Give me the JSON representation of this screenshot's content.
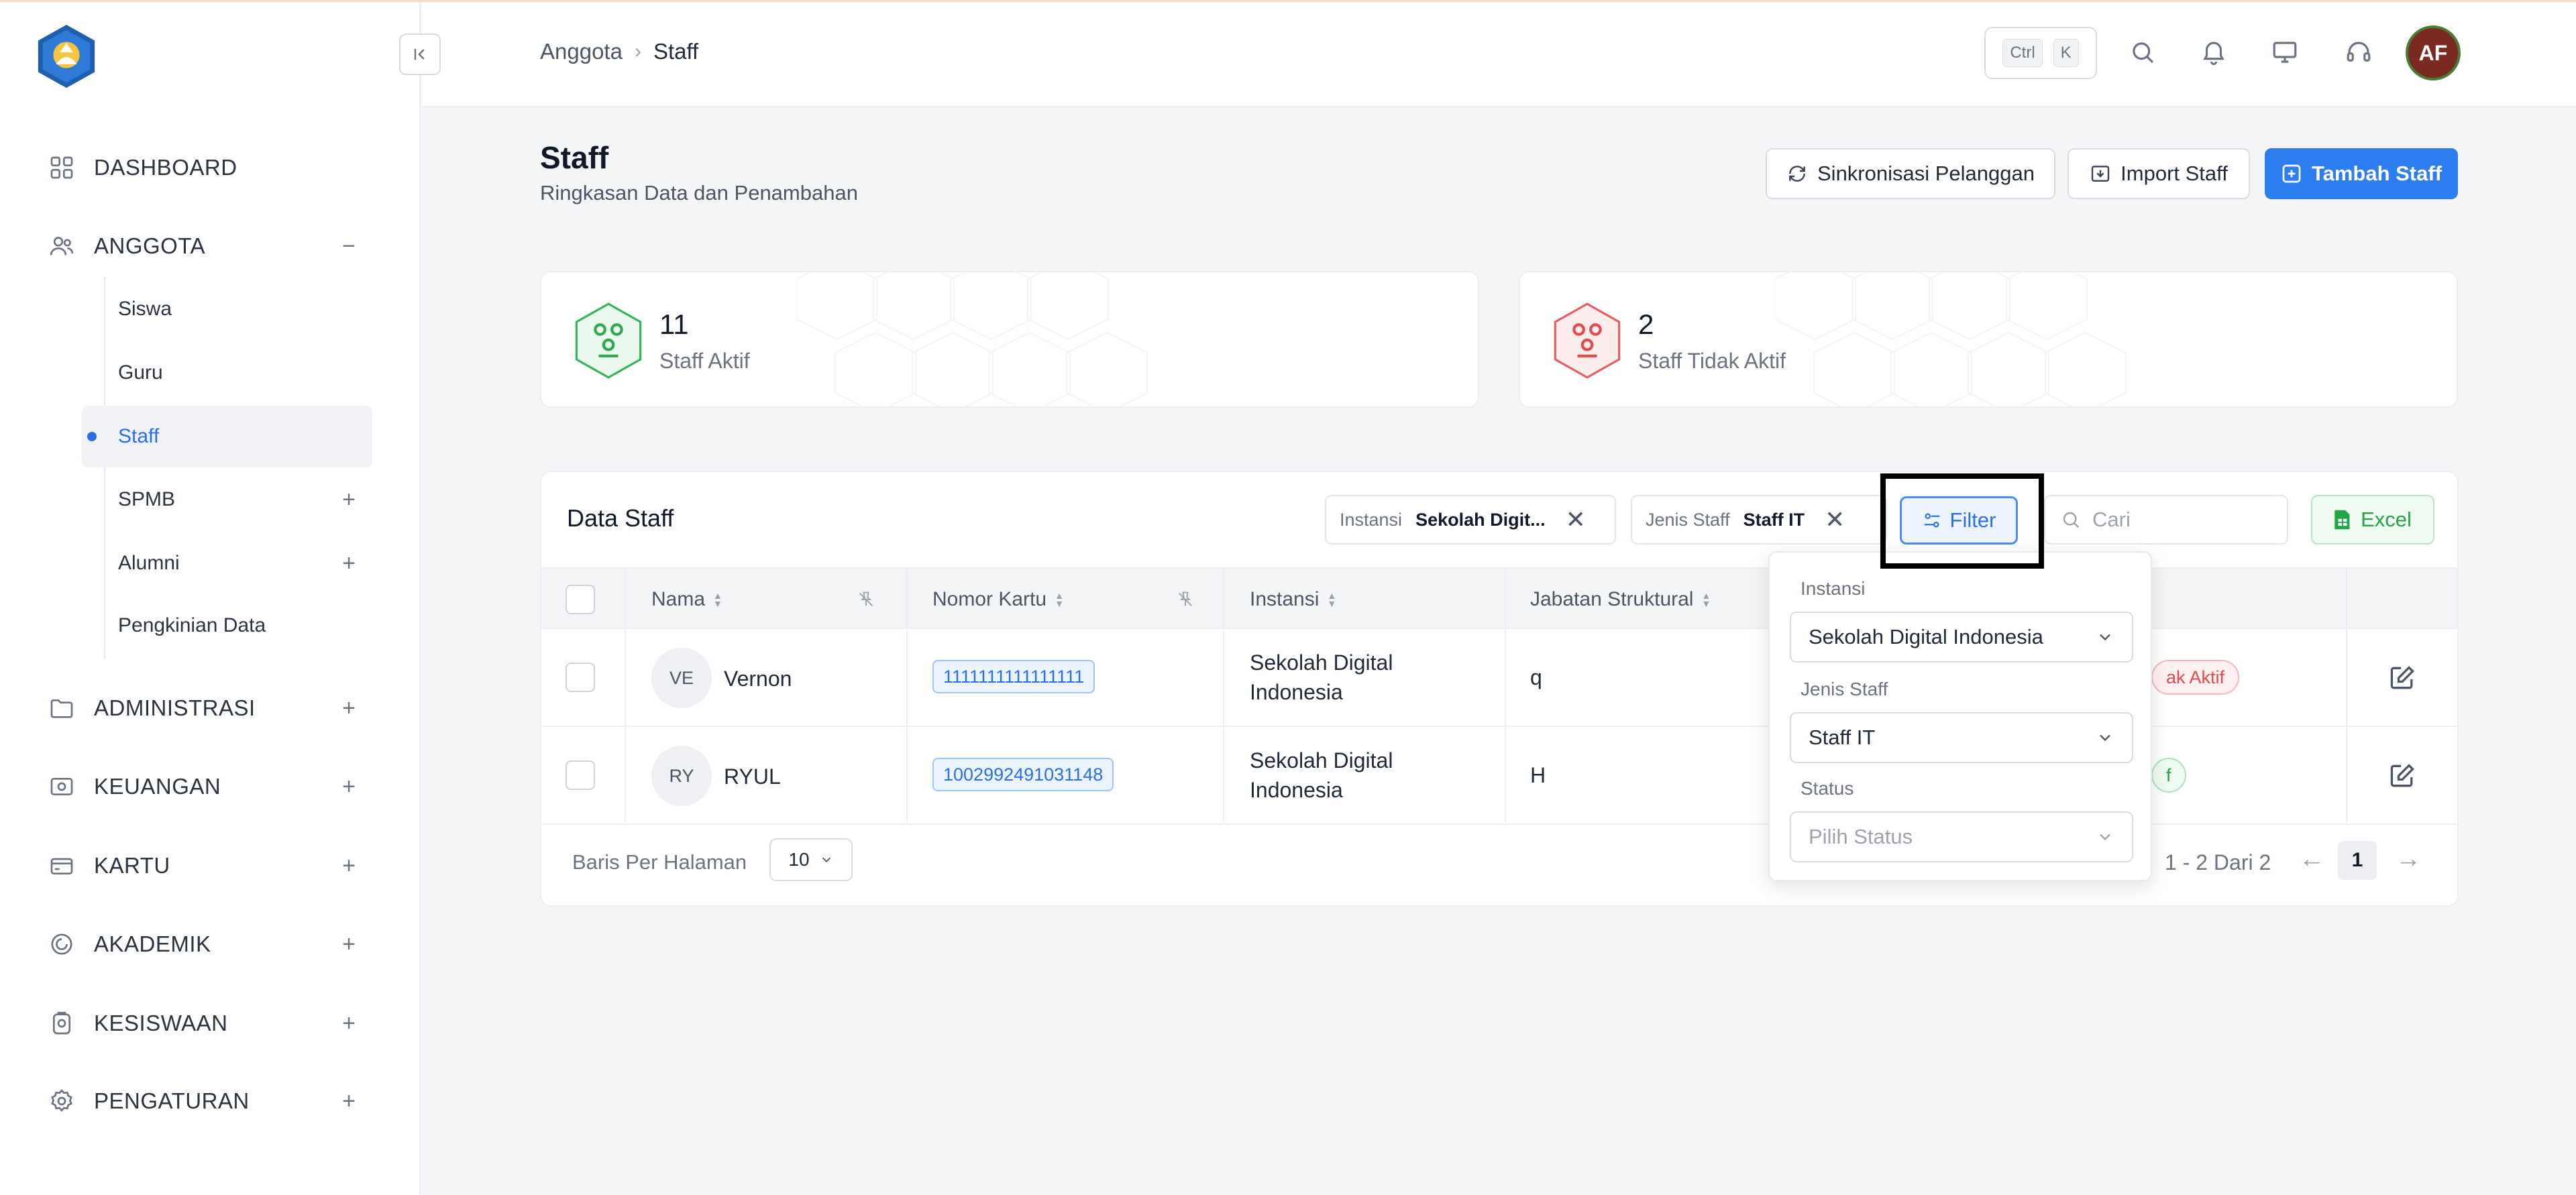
{
  "header": {
    "breadcrumb": {
      "parent": "Anggota",
      "separator": "›",
      "current": "Staff"
    },
    "shortcut": {
      "key1": "Ctrl",
      "key2": "K"
    },
    "avatar_initials": "AF"
  },
  "sidebar": {
    "items": [
      {
        "label": "DASHBOARD",
        "icon": "dashboard-grid-icon"
      },
      {
        "label": "ANGGOTA",
        "icon": "users-icon",
        "toggle": "−"
      },
      {
        "label": "ADMINISTRASI",
        "icon": "folder-icon",
        "toggle": "+"
      },
      {
        "label": "KEUANGAN",
        "icon": "money-icon",
        "toggle": "+"
      },
      {
        "label": "KARTU",
        "icon": "card-icon",
        "toggle": "+"
      },
      {
        "label": "AKADEMIK",
        "icon": "academic-icon",
        "toggle": "+"
      },
      {
        "label": "KESISWAAN",
        "icon": "badge-icon",
        "toggle": "+"
      },
      {
        "label": "PENGATURAN",
        "icon": "gear-icon",
        "toggle": "+"
      }
    ],
    "sub_items": [
      {
        "label": "Siswa"
      },
      {
        "label": "Guru"
      },
      {
        "label": "Staff",
        "active": true
      },
      {
        "label": "SPMB",
        "toggle": "+"
      },
      {
        "label": "Alumni",
        "toggle": "+"
      },
      {
        "label": "Pengkinian Data"
      }
    ]
  },
  "page": {
    "title": "Staff",
    "subtitle": "Ringkasan Data dan Penambahan",
    "buttons": {
      "sync": "Sinkronisasi Pelanggan",
      "import": "Import Staff",
      "add": "Tambah Staff"
    }
  },
  "stats": [
    {
      "value": "11",
      "label": "Staff Aktif",
      "color": "#2fa84f"
    },
    {
      "value": "2",
      "label": "Staff Tidak Aktif",
      "color": "#e5484d"
    }
  ],
  "table": {
    "title": "Data Staff",
    "chips": [
      {
        "key": "Instansi",
        "value": "Sekolah Digit...",
        "close": "✕"
      },
      {
        "key": "Jenis Staff",
        "value": "Staff IT",
        "close": "✕"
      }
    ],
    "filter_label": "Filter",
    "search_placeholder": "Cari",
    "excel_label": "Excel",
    "columns": [
      "Nama",
      "Nomor Kartu",
      "Instansi",
      "Jabatan Struktural"
    ],
    "rows": [
      {
        "initials": "VE",
        "name": "Vernon",
        "card": "1111111111111111",
        "instansi_line1": "Sekolah Digital",
        "instansi_line2": "Indonesia",
        "jabatan": "q",
        "status": "ak Aktif"
      },
      {
        "initials": "RY",
        "name": "RYUL",
        "card": "1002992491031148",
        "instansi_line1": "Sekolah Digital",
        "instansi_line2": "Indonesia",
        "jabatan": "H",
        "status": "f"
      }
    ],
    "pagination": {
      "label": "Baris Per Halaman",
      "per_page": "10",
      "range": "1 - 2 Dari 2",
      "prev": "←",
      "next": "→",
      "page": "1"
    }
  },
  "filter_panel": {
    "instansi_label": "Instansi",
    "instansi_value": "Sekolah Digital Indonesia",
    "jenis_label": "Jenis Staff",
    "jenis_value": "Staff IT",
    "status_label": "Status",
    "status_placeholder": "Pilih Status"
  }
}
